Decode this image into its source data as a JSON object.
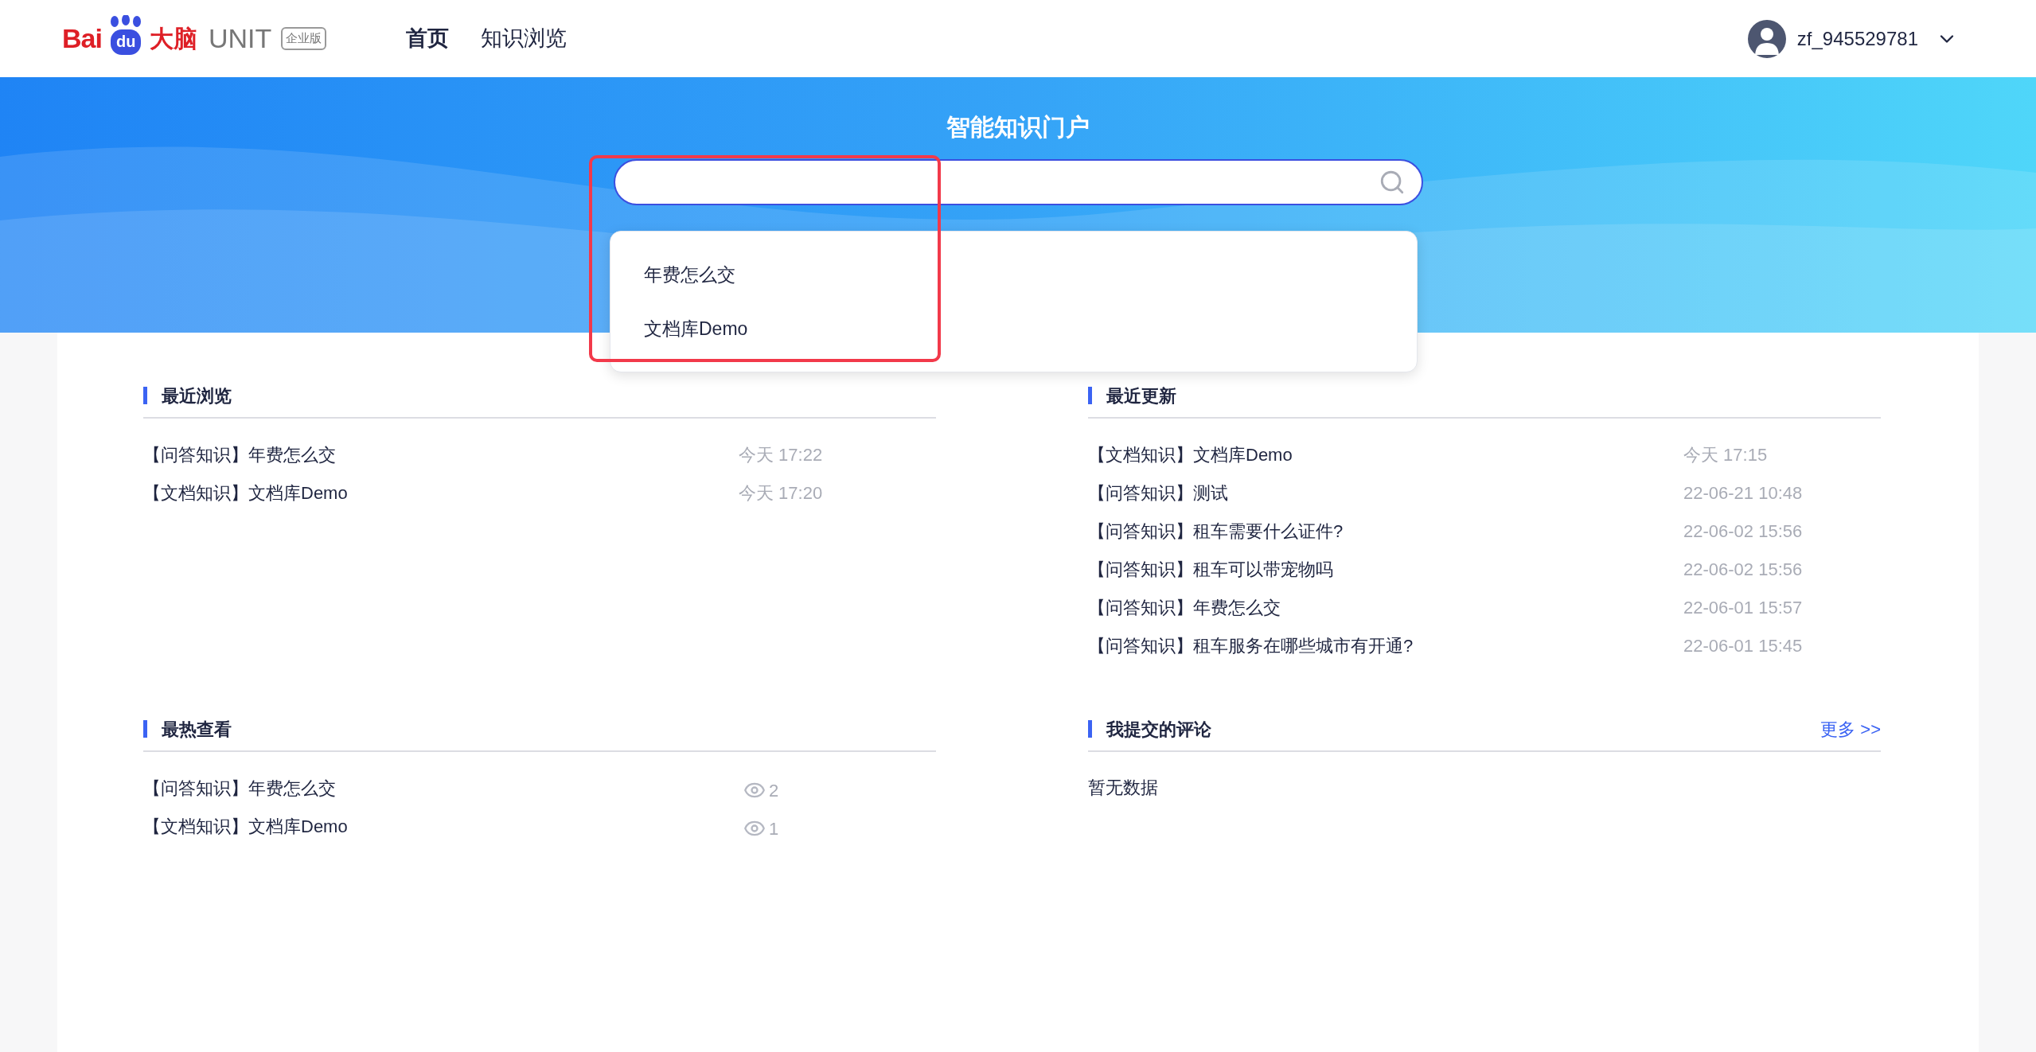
{
  "header": {
    "logo": {
      "bai": "Bai",
      "du": "du",
      "brain": "大脑",
      "product": "UNIT",
      "edition": "企业版"
    },
    "nav": [
      {
        "label": "首页",
        "selected": true
      },
      {
        "label": "知识浏览",
        "selected": false
      }
    ],
    "user": {
      "name": "zf_945529781"
    }
  },
  "banner": {
    "title": "智能知识门户",
    "search": {
      "suggestions": [
        "年费怎么交",
        "文档库Demo"
      ]
    }
  },
  "sections": [
    {
      "title": "最近浏览",
      "kind": "time",
      "items": [
        {
          "text": "【问答知识】年费怎么交",
          "meta": "今天 17:22"
        },
        {
          "text": "【文档知识】文档库Demo",
          "meta": "今天 17:20"
        }
      ]
    },
    {
      "title": "最近更新",
      "kind": "time",
      "items": [
        {
          "text": "【文档知识】文档库Demo",
          "meta": "今天 17:15"
        },
        {
          "text": "【问答知识】测试",
          "meta": "22-06-21 10:48"
        },
        {
          "text": "【问答知识】租车需要什么证件?",
          "meta": "22-06-02 15:56"
        },
        {
          "text": "【问答知识】租车可以带宠物吗",
          "meta": "22-06-02 15:56"
        },
        {
          "text": "【问答知识】年费怎么交",
          "meta": "22-06-01 15:57"
        },
        {
          "text": "【问答知识】租车服务在哪些城市有开通?",
          "meta": "22-06-01 15:45"
        }
      ]
    },
    {
      "title": "最热查看",
      "kind": "views",
      "items": [
        {
          "text": "【问答知识】年费怎么交",
          "meta": "2"
        },
        {
          "text": "【文档知识】文档库Demo",
          "meta": "1"
        }
      ]
    },
    {
      "title": "我提交的评论",
      "kind": "empty",
      "more": "更多 >>",
      "empty_text": "暂无数据"
    }
  ]
}
